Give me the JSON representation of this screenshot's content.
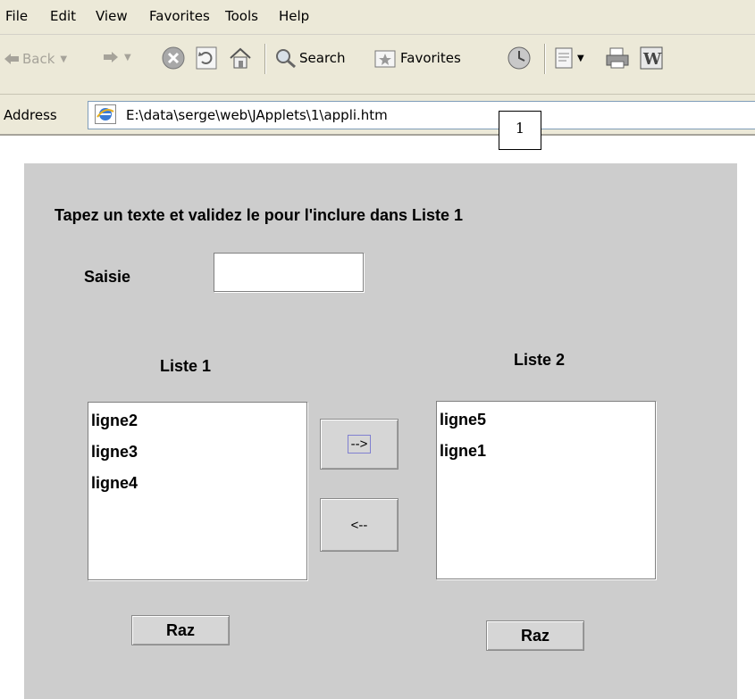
{
  "menu": {
    "items": [
      "File",
      "Edit",
      "View",
      "Favorites",
      "Tools",
      "Help"
    ]
  },
  "toolbar": {
    "back_label": "Back",
    "search_label": "Search",
    "favorites_label": "Favorites"
  },
  "address": {
    "label": "Address",
    "url": "E:\\data\\serge\\web\\JApplets\\1\\appli.htm"
  },
  "callout": {
    "number": "1"
  },
  "applet": {
    "instruction": "Tapez un texte et validez le pour l'inclure dans Liste 1",
    "saisie_label": "Saisie",
    "saisie_value": "",
    "list1": {
      "title": "Liste 1",
      "items": [
        "ligne2",
        "ligne3",
        "ligne4"
      ]
    },
    "list2": {
      "title": "Liste 2",
      "items": [
        "ligne5",
        "ligne1"
      ]
    },
    "move_right_label": "-->",
    "move_left_label": "<--",
    "raz1_label": "Raz",
    "raz2_label": "Raz"
  },
  "colors": {
    "chrome_bg": "#ece9d8",
    "applet_bg": "#cdcdcd"
  }
}
